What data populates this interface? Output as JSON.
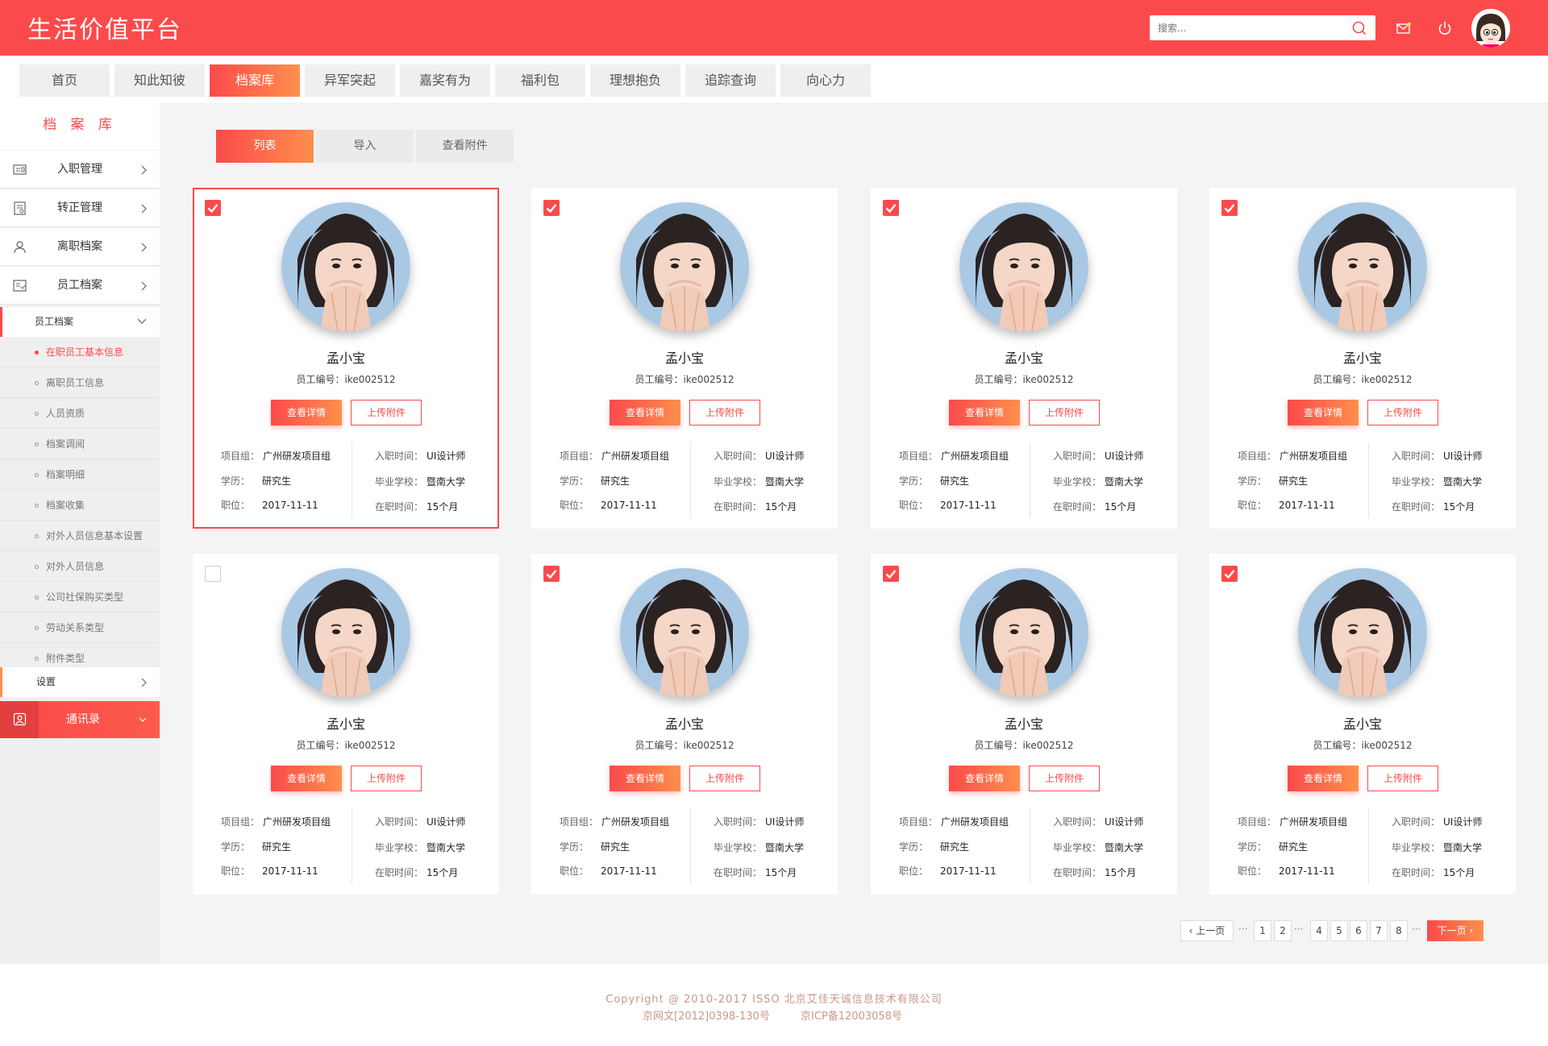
{
  "header": {
    "app_title": "生活价值平台",
    "search_placeholder": "搜索...",
    "brand_color": "#fb4a4b",
    "accent_color": "#ff8f4c"
  },
  "nav": {
    "tabs": [
      {
        "label": "首页"
      },
      {
        "label": "知此知彼"
      },
      {
        "label": "档案库",
        "active": true
      },
      {
        "label": "异军突起"
      },
      {
        "label": "嘉奖有为"
      },
      {
        "label": "福利包"
      },
      {
        "label": "理想抱负"
      },
      {
        "label": "追踪查询"
      },
      {
        "label": "向心力"
      }
    ]
  },
  "sidebar": {
    "title": "档 案 库",
    "items": [
      {
        "label": "入职管理",
        "icon": "id-card-icon"
      },
      {
        "label": "转正管理",
        "icon": "document-icon"
      },
      {
        "label": "离职档案",
        "icon": "person-icon"
      },
      {
        "label": "员工档案",
        "icon": "archive-icon"
      }
    ],
    "group": {
      "label": "员工档案",
      "expanded": true
    },
    "sub_items": [
      {
        "label": "在职员工基本信息",
        "active": true
      },
      {
        "label": "离职员工信息"
      },
      {
        "label": "人员资质"
      },
      {
        "label": "档案调阅"
      },
      {
        "label": "档案明细"
      },
      {
        "label": "档案收集"
      },
      {
        "label": "对外人员信息基本设置"
      },
      {
        "label": "对外人员信息"
      },
      {
        "label": "公司社保购买类型"
      },
      {
        "label": "劳动关系类型"
      },
      {
        "label": "附件类型"
      }
    ],
    "settings": {
      "label": "设置"
    },
    "contacts": {
      "label": "通讯录"
    }
  },
  "subtabs": [
    {
      "label": "列表",
      "active": true
    },
    {
      "label": "导入"
    },
    {
      "label": "查看附件"
    }
  ],
  "card_labels": {
    "detail_btn": "查看详情",
    "upload_btn": "上传附件",
    "project_key": "项目组：",
    "education_key": "学历：",
    "position_key": "职位：",
    "join_key": "入职时间：",
    "school_key": "毕业学校：",
    "tenure_key": "在职时间："
  },
  "cards": [
    {
      "checked": true,
      "selected": true,
      "name": "孟小宝",
      "id_text": "员工编号：ike002512",
      "project": "广州研发项目组",
      "education": "研究生",
      "position": "2017-11-11",
      "join": "UI设计师",
      "school": "暨南大学",
      "tenure": "15个月"
    },
    {
      "checked": true,
      "name": "孟小宝",
      "id_text": "员工编号：ike002512",
      "project": "广州研发项目组",
      "education": "研究生",
      "position": "2017-11-11",
      "join": "UI设计师",
      "school": "暨南大学",
      "tenure": "15个月"
    },
    {
      "checked": true,
      "name": "孟小宝",
      "id_text": "员工编号：ike002512",
      "project": "广州研发项目组",
      "education": "研究生",
      "position": "2017-11-11",
      "join": "UI设计师",
      "school": "暨南大学",
      "tenure": "15个月"
    },
    {
      "checked": true,
      "name": "孟小宝",
      "id_text": "员工编号：ike002512",
      "project": "广州研发项目组",
      "education": "研究生",
      "position": "2017-11-11",
      "join": "UI设计师",
      "school": "暨南大学",
      "tenure": "15个月"
    },
    {
      "checked": false,
      "name": "孟小宝",
      "id_text": "员工编号：ike002512",
      "project": "广州研发项目组",
      "education": "研究生",
      "position": "2017-11-11",
      "join": "UI设计师",
      "school": "暨南大学",
      "tenure": "15个月"
    },
    {
      "checked": true,
      "name": "孟小宝",
      "id_text": "员工编号：ike002512",
      "project": "广州研发项目组",
      "education": "研究生",
      "position": "2017-11-11",
      "join": "UI设计师",
      "school": "暨南大学",
      "tenure": "15个月"
    },
    {
      "checked": true,
      "name": "孟小宝",
      "id_text": "员工编号：ike002512",
      "project": "广州研发项目组",
      "education": "研究生",
      "position": "2017-11-11",
      "join": "UI设计师",
      "school": "暨南大学",
      "tenure": "15个月"
    },
    {
      "checked": true,
      "name": "孟小宝",
      "id_text": "员工编号：ike002512",
      "project": "广州研发项目组",
      "education": "研究生",
      "position": "2017-11-11",
      "join": "UI设计师",
      "school": "暨南大学",
      "tenure": "15个月"
    }
  ],
  "pagination": {
    "prev": "上一页",
    "next": "下一页",
    "ellipsis": "···",
    "pages": [
      "1",
      "2",
      "4",
      "5",
      "6",
      "7",
      "8"
    ]
  },
  "footer": {
    "copyright": "Copyright @ 2010-2017 ISSO 北京艾佳天诚信息技术有限公司",
    "icp_1": "京网文[2012]0398-130号",
    "icp_2": "京ICP备12003058号"
  }
}
